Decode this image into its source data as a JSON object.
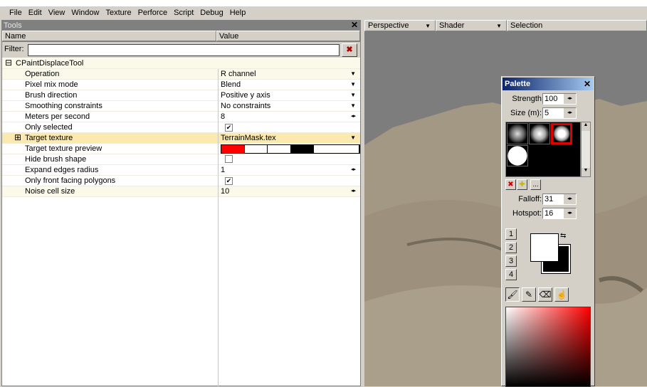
{
  "menu": [
    "File",
    "Edit",
    "View",
    "Window",
    "Texture",
    "Perforce",
    "Script",
    "Debug",
    "Help"
  ],
  "tools": {
    "title": "Tools",
    "close": "✕",
    "columns": {
      "name": "Name",
      "value": "Value"
    },
    "filter": {
      "label": "Filter:",
      "value": "",
      "clear": "✖"
    },
    "root": {
      "expander": "⊟",
      "label": "CPaintDisplaceTool"
    },
    "rows": [
      {
        "name": "Operation",
        "value": "R channel"
      },
      {
        "name": "Pixel mix mode",
        "value": "Blend"
      },
      {
        "name": "Brush direction",
        "value": "Positive y axis"
      },
      {
        "name": "Smoothing constraints",
        "value": "No constraints"
      },
      {
        "name": "Meters per second",
        "value": "8"
      },
      {
        "name": "Only selected",
        "checked": true
      },
      {
        "name": "Target texture",
        "value": "TerrainMask.tex",
        "expander": "⊞"
      },
      {
        "name": "Target texture preview",
        "swatches": [
          "#ff0000",
          "#ffffff",
          "#ffffff",
          "#000000",
          "#ffffff"
        ]
      },
      {
        "name": "Hide brush shape",
        "checked": false
      },
      {
        "name": "Expand edges radius",
        "value": "1"
      },
      {
        "name": "Only front facing polygons",
        "checked": true
      },
      {
        "name": "Noise cell size",
        "value": "10"
      }
    ]
  },
  "viewport": {
    "dropdowns": [
      "Perspective",
      "Shader",
      "Selection"
    ]
  },
  "palette": {
    "title": "Palette",
    "close": "✕",
    "strength": {
      "label": "Strength",
      "value": "100"
    },
    "size": {
      "label": "Size (m):",
      "value": "5"
    },
    "falloff": {
      "label": "Falloff:",
      "value": "31"
    },
    "hotspot": {
      "label": "Hotspot:",
      "value": "16"
    },
    "brush_buttons": [
      "✖",
      "✚",
      "..."
    ],
    "slots": [
      "1",
      "2",
      "3",
      "4"
    ],
    "swap": "⇆",
    "colors": {
      "foreground": "#ffffff",
      "background": "#000000",
      "picker_hue": "#ff0000"
    },
    "tools": [
      "brush-icon",
      "eyedropper-icon",
      "eraser-icon",
      "smudge-icon"
    ]
  }
}
